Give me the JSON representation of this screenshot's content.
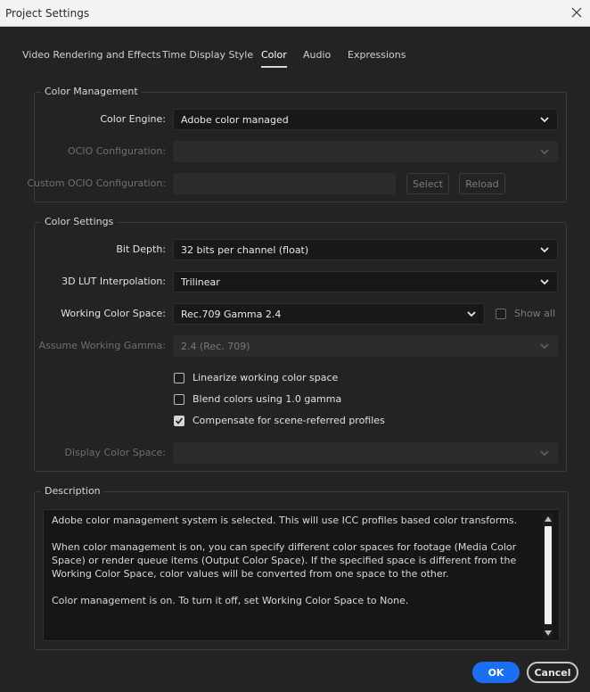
{
  "window": {
    "title": "Project Settings"
  },
  "tabs": [
    {
      "label": "Video Rendering and Effects"
    },
    {
      "label": "Time Display Style"
    },
    {
      "label": "Color",
      "active": true
    },
    {
      "label": "Audio"
    },
    {
      "label": "Expressions"
    }
  ],
  "color_management": {
    "group_label": "Color Management",
    "color_engine": {
      "label": "Color Engine:",
      "value": "Adobe color managed"
    },
    "ocio_configuration": {
      "label": "OCIO Configuration:",
      "value": ""
    },
    "custom_ocio": {
      "label": "Custom OCIO Configuration:",
      "value": "",
      "select_label": "Select",
      "reload_label": "Reload"
    }
  },
  "color_settings": {
    "group_label": "Color Settings",
    "bit_depth": {
      "label": "Bit Depth:",
      "value": "32 bits per channel (float)"
    },
    "lut_interpolation": {
      "label": "3D LUT Interpolation:",
      "value": "Trilinear"
    },
    "working_color_space": {
      "label": "Working Color Space:",
      "value": "Rec.709 Gamma 2.4",
      "show_all_label": "Show all",
      "show_all_checked": false
    },
    "assume_working_gamma": {
      "label": "Assume Working Gamma:",
      "value": "2.4 (Rec. 709)"
    },
    "checkboxes": [
      {
        "label": "Linearize working color space",
        "checked": false
      },
      {
        "label": "Blend colors using 1.0 gamma",
        "checked": false
      },
      {
        "label": "Compensate for scene-referred profiles",
        "checked": true
      }
    ],
    "display_color_space": {
      "label": "Display Color Space:",
      "value": ""
    }
  },
  "description": {
    "group_label": "Description",
    "text": "Adobe color management system is selected. This will use ICC profiles based color transforms.\n\nWhen color management is on, you can specify different color spaces for footage (Media Color Space) or render queue items (Output Color Space). If the specified space is different from the Working Color Space, color values will be converted from one space to the other.\n\nColor management is on. To turn it off, set Working Color Space to None."
  },
  "footer": {
    "ok_label": "OK",
    "cancel_label": "Cancel"
  },
  "colors": {
    "accent": "#1b6ff5",
    "background": "#232323"
  },
  "icons": {
    "close": "close-icon",
    "chevron": "chevron-down-icon",
    "check": "checkmark-icon"
  }
}
